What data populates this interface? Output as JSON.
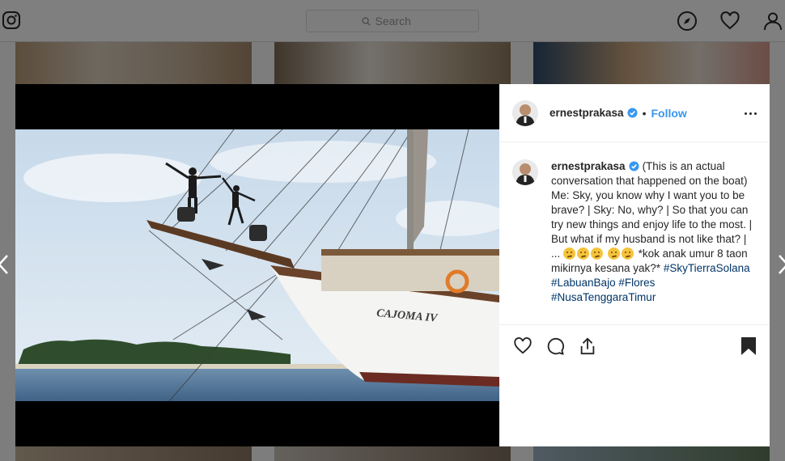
{
  "topbar": {
    "logo_icon": "instagram-icon",
    "search_placeholder": "Search",
    "icons": [
      "compass-icon",
      "heart-icon",
      "profile-icon"
    ]
  },
  "post": {
    "username": "ernestprakasa",
    "verified": true,
    "separator": "•",
    "follow_label": "Follow",
    "caption_text": "(This is an actual conversation that happened on the boat) Me: Sky, you know why I want you to be brave? | Sky: No, why? | So that you can try new things and enjoy life to the most. | But what if my husband is not like that? | ...",
    "caption_suffix": "*kok anak umur 8 taon mikirnya kesana yak?*",
    "emoji_icon": "thinking-face-emoji",
    "hashtags": [
      "#SkyTierraSolana",
      "#LabuanBajo",
      "#Flores",
      "#NusaTenggaraTimur"
    ],
    "boat_name": "CAJOMA IV"
  },
  "colors": {
    "link": "#3897f0",
    "hashtag": "#003569",
    "text": "#262626"
  }
}
